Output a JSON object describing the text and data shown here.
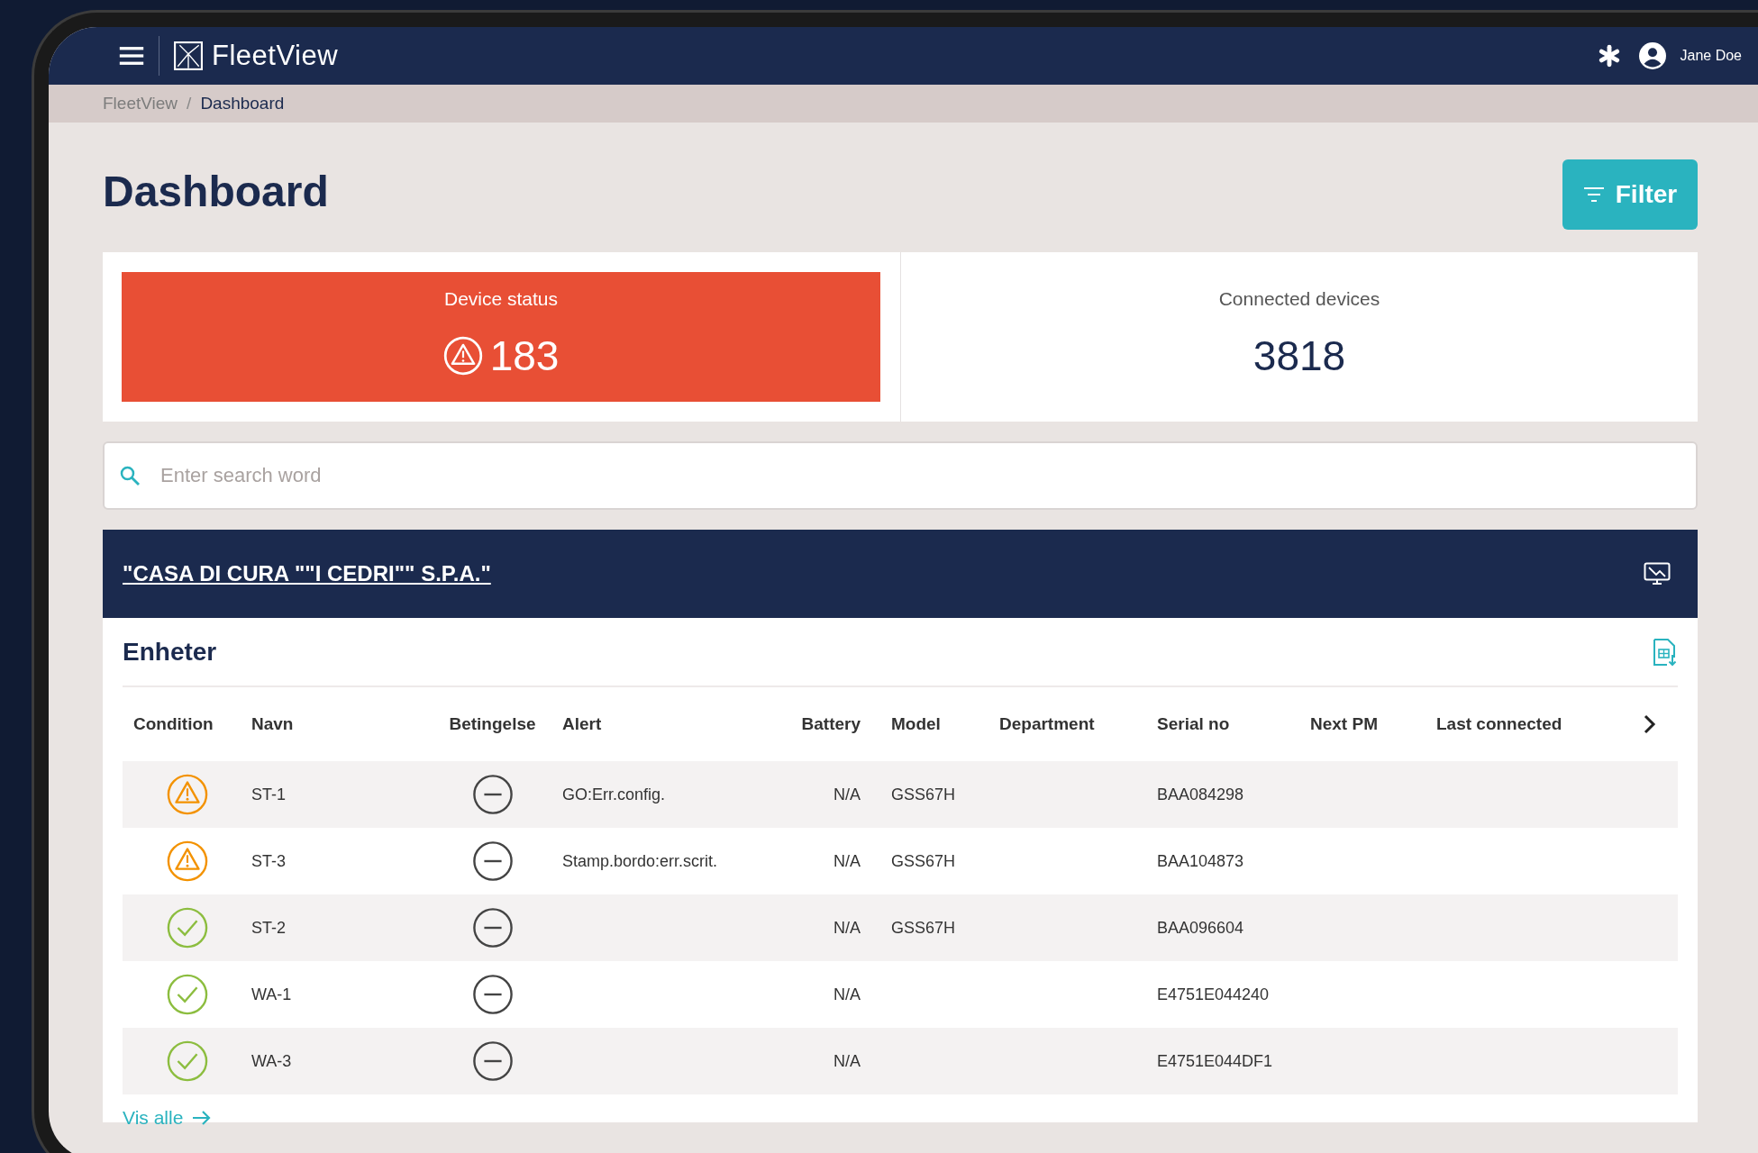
{
  "app_bar": {
    "app_name": "FleetView",
    "user_name": "Jane Doe"
  },
  "breadcrumb": [
    {
      "label": "FleetView",
      "current": false
    },
    {
      "label": "Dashboard",
      "current": true
    }
  ],
  "breadcrumb_separator": "/",
  "page_title": "Dashboard",
  "filter_button": {
    "label": "Filter"
  },
  "summary_cards": [
    {
      "title": "Device status",
      "value": "183",
      "kind": "alert"
    },
    {
      "title": "Connected devices",
      "value": "3818",
      "kind": "plain"
    }
  ],
  "search": {
    "placeholder": "Enter search word"
  },
  "customer": {
    "name": "\"CASA DI CURA \"\"I CEDRI\"\" S.P.A.\""
  },
  "devices": {
    "title": "Enheter",
    "columns": [
      "Condition",
      "Navn",
      "Betingelse",
      "Alert",
      "Battery",
      "Model",
      "Department",
      "Serial no",
      "Next PM",
      "Last connected"
    ],
    "rows": [
      {
        "kind": "warning",
        "name": "ST-1",
        "alert": "GO:Err.config.",
        "battery": "N/A",
        "model": "GSS67H",
        "serial": "BAA084298"
      },
      {
        "kind": "warning",
        "name": "ST-3",
        "alert": "Stamp.bordo:err.scrit.",
        "battery": "N/A",
        "model": "GSS67H",
        "serial": "BAA104873"
      },
      {
        "kind": "ok",
        "name": "ST-2",
        "battery": "N/A",
        "model": "GSS67H",
        "serial": "BAA096604"
      },
      {
        "kind": "ok",
        "name": "WA-1",
        "battery": "N/A",
        "serial": "E4751E044240"
      },
      {
        "kind": "ok",
        "name": "WA-3",
        "battery": "N/A",
        "serial": "E4751E044DF1"
      }
    ],
    "show_all": "Vis alle"
  }
}
